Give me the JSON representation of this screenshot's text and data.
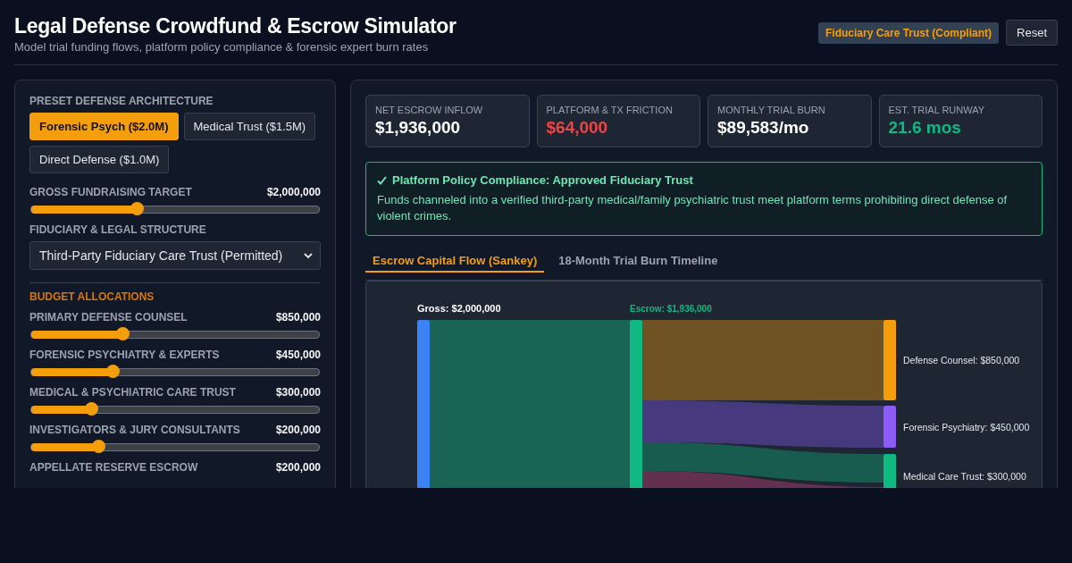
{
  "header": {
    "title": "Legal Defense Crowdfund & Escrow Simulator",
    "subtitle": "Model trial funding flows, platform policy compliance & forensic expert burn rates",
    "status_badge": "Fiduciary Care Trust (Compliant)",
    "reset_button": "Reset"
  },
  "controls": {
    "preset_heading": "PRESET DEFENSE ARCHITECTURE",
    "presets": [
      {
        "label": "Forensic Psych ($2.0M)",
        "selected": true
      },
      {
        "label": "Medical Trust ($1.5M)",
        "selected": false
      },
      {
        "label": "Direct Defense ($1.0M)",
        "selected": false
      }
    ],
    "target": {
      "label": "GROSS FUNDRAISING TARGET",
      "value": "$2,000,000",
      "level": 0.37
    },
    "structure": {
      "label": "FIDUCIARY & LEGAL STRUCTURE",
      "value": "Third-Party Fiduciary Care Trust (Permitted)"
    },
    "budget_heading": "BUDGET ALLOCATIONS",
    "allocations": [
      {
        "label": "PRIMARY DEFENSE COUNSEL",
        "value": "$850,000",
        "level": 0.32
      },
      {
        "label": "FORENSIC PSYCHIATRY & EXPERTS",
        "value": "$450,000",
        "level": 0.285
      },
      {
        "label": "MEDICAL & PSYCHIATRIC CARE TRUST",
        "value": "$300,000",
        "level": 0.21
      },
      {
        "label": "INVESTIGATORS & JURY CONSULTANTS",
        "value": "$200,000",
        "level": 0.235
      },
      {
        "label": "APPELLATE RESERVE ESCROW",
        "value": "$200,000"
      }
    ]
  },
  "metrics": [
    {
      "label": "NET ESCROW INFLOW",
      "value": "$1,936,000",
      "color": "#ffffff"
    },
    {
      "label": "PLATFORM & TX FRICTION",
      "value": "$64,000",
      "color": "#ef4444"
    },
    {
      "label": "MONTHLY TRIAL BURN",
      "value": "$89,583/mo",
      "color": "#ffffff"
    },
    {
      "label": "EST. TRIAL RUNWAY",
      "value": "21.6 mos",
      "color": "#10b981"
    }
  ],
  "compliance": {
    "title": "Platform Policy Compliance: Approved Fiduciary Trust",
    "text": "Funds channeled into a verified third-party medical/family psychiatric trust meet platform terms prohibiting direct defense of violent crimes."
  },
  "tabs": [
    {
      "label": "Escrow Capital Flow (Sankey)",
      "selected": true
    },
    {
      "label": "18-Month Trial Burn Timeline",
      "selected": false
    }
  ],
  "flow": {
    "source_label": "Gross: $2,000,000",
    "escrow_label": "Escrow: $1,936,000",
    "targets": [
      {
        "label": "Defense Counsel: $850,000",
        "color": "#f59e0b"
      },
      {
        "label": "Forensic Psychiatry: $450,000",
        "color": "#8b5cf6"
      },
      {
        "label": "Medical Care Trust: $300,000",
        "color": "#10b981"
      },
      {
        "color": "#64304f"
      }
    ]
  }
}
